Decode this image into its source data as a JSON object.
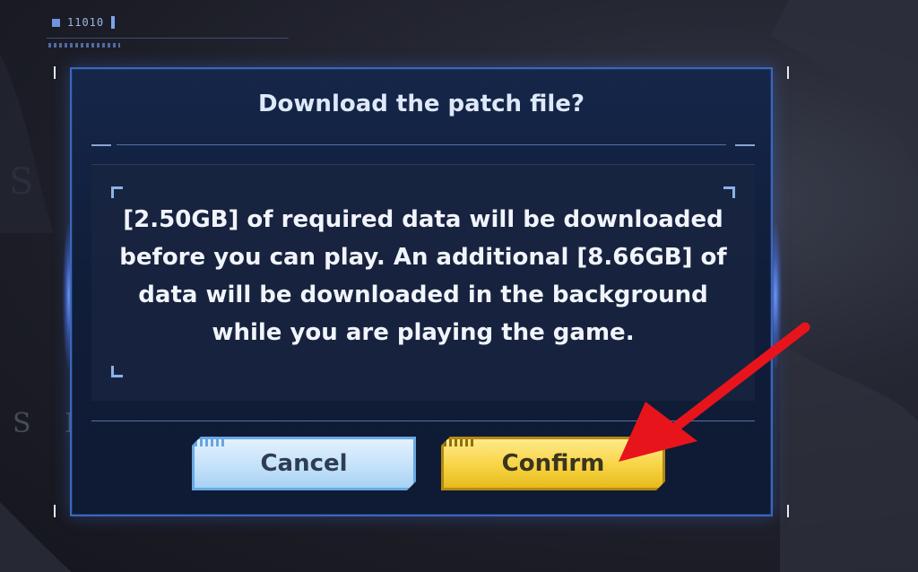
{
  "hud": {
    "code": "11010"
  },
  "background": {
    "ghost_letter": "S",
    "ghost_word": "S E"
  },
  "dialog": {
    "title": "Download the patch file?",
    "message_lines": [
      "[2.50GB] of required data will be downloaded",
      "before you can play. An additional [8.66GB] of",
      "data will be downloaded in the background",
      "while you are playing the game."
    ],
    "required_size": "2.50GB",
    "additional_size": "8.66GB",
    "buttons": {
      "cancel": "Cancel",
      "confirm": "Confirm"
    }
  },
  "colors": {
    "dialog_border": "#3a68b9",
    "cancel_button": "#c4e2fa",
    "confirm_button": "#f7d443",
    "annotation_arrow": "#e8141c"
  },
  "annotation": {
    "arrow_icon": "red-arrow-icon",
    "points_to": "confirm-button"
  }
}
